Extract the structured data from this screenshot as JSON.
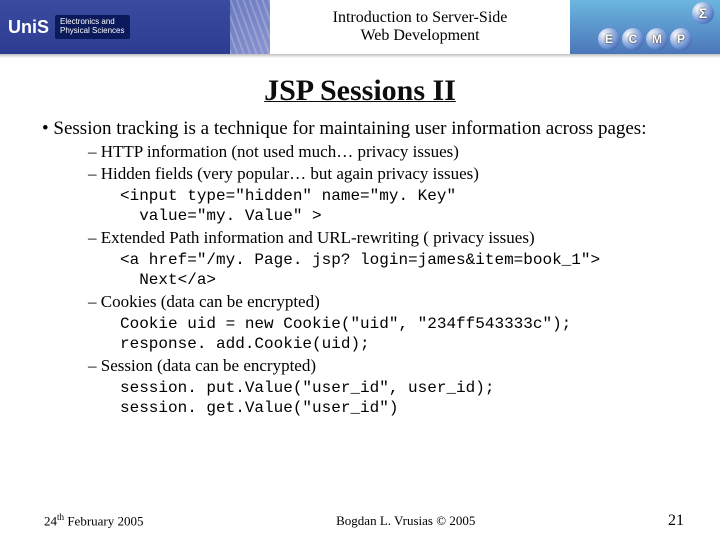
{
  "header": {
    "logo_text": "UniS",
    "dept_line1": "Electronics and",
    "dept_line2": "Physical Sciences",
    "course_line1": "Introduction to Server-Side",
    "course_line2": "Web Development",
    "orbs": {
      "e": "E",
      "c": "C",
      "m": "M",
      "p": "P",
      "sigma": "Σ"
    }
  },
  "title": "JSP Sessions II",
  "bullet_main": "Session tracking is a technique for maintaining user information across pages:",
  "items": {
    "http": "HTTP information (not used much… privacy issues)",
    "hidden": "Hidden fields (very popular… but again privacy issues)",
    "hidden_code": "<input type=\"hidden\" name=\"my. Key\"\n  value=\"my. Value\" >",
    "url": "Extended Path information and URL-rewriting ( privacy issues)",
    "url_code": "<a href=\"/my. Page. jsp? login=james&item=book_1\">\n  Next</a>",
    "cookies": "Cookies (data can be encrypted)",
    "cookies_code": "Cookie uid = new Cookie(\"uid\", \"234ff543333c\");\nresponse. add.Cookie(uid);",
    "session": "Session (data can be encrypted)",
    "session_code": "session. put.Value(\"user_id\", user_id);\nsession. get.Value(\"user_id\")"
  },
  "footer": {
    "date_day": "24",
    "date_suffix": "th",
    "date_rest": " February 2005",
    "author": "Bogdan L. Vrusias © 2005",
    "page": "21"
  }
}
